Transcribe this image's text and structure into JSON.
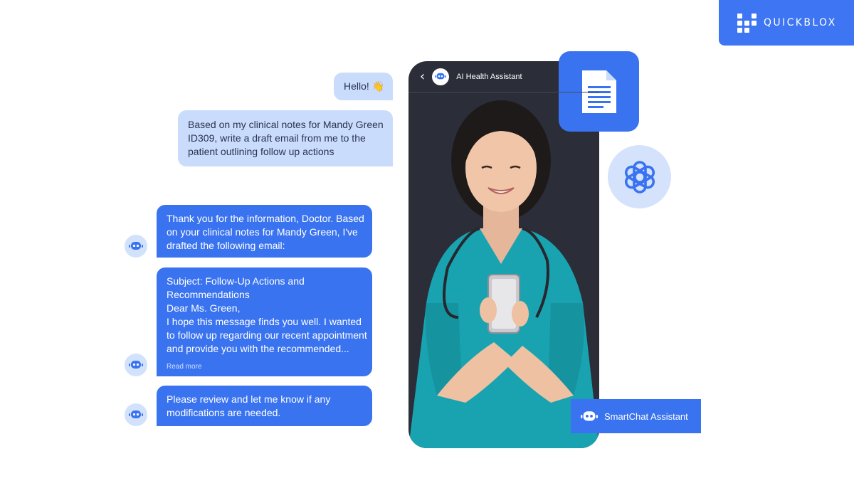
{
  "brand": {
    "name": "QUICKBLOX"
  },
  "phone": {
    "header_title": "AI Health Assistant"
  },
  "chat": {
    "user_messages": [
      {
        "lines": [
          "Hello! 👋"
        ]
      },
      {
        "lines": [
          "Based on my clinical notes for Mandy Green",
          "ID309, write a draft email from me to the",
          "patient outlining follow up actions"
        ]
      }
    ],
    "bot_messages": [
      {
        "lines": [
          "Thank you for the information, Doctor. Based",
          "on your clinical notes for Mandy Green, I've",
          "drafted the following email:"
        ]
      },
      {
        "lines": [
          "Subject: Follow-Up Actions and",
          "Recommendations",
          "Dear Ms. Green,",
          "I hope this message finds you well. I wanted",
          "to follow up regarding our recent appointment",
          "and provide you with the recommended..."
        ],
        "read_more": "Read more"
      },
      {
        "lines": [
          "Please review and let me know if any",
          "modifications are needed."
        ]
      }
    ]
  },
  "badge": {
    "label": "SmartChat Assistant"
  },
  "icons": {
    "document": "document-icon",
    "openai": "openai-logo-icon",
    "bot": "robot-icon",
    "back": "chevron-left-icon"
  },
  "colors": {
    "accent": "#3a73f0",
    "user_bubble": "#c9dcfb",
    "phone_bg": "#2b2e38",
    "scrub": "#19a3b0"
  }
}
